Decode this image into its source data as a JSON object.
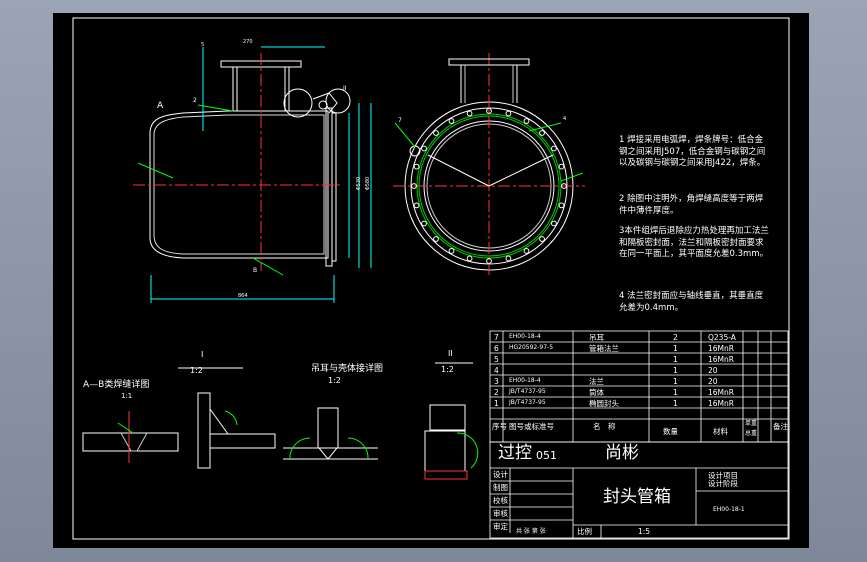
{
  "drawing": {
    "title": "封头管箱",
    "code": "EH00-18-1",
    "scale": "1:5",
    "watermark_part1": "过控",
    "watermark_part2": "051",
    "watermark_part3": "尚彬"
  },
  "notes": [
    "1 焊接采用电弧焊，焊条牌号：低合金钢之间采用J507，低合金钢与碳钢之间以及碳钢与碳钢之间采用J422，焊条。",
    "2 除图中注明外，角焊缝高度等于两焊件中薄件厚度。",
    "3本件组焊后退除应力热处理再加工法兰和隔板密封面，法兰和隔板密封面要求在同一平面上，其平面度允差0.3mm。",
    "4 法兰密封面应与轴线垂直，其垂直度允差为0.4mm。"
  ],
  "detail_labels": {
    "section_ab": "A—B类焊缝详图",
    "section_ab_scale": "1:1",
    "detail_i_num": "I",
    "detail_i_scale": "1:2",
    "lug_title": "吊耳与壳体接详图",
    "lug_scale": "1:2",
    "detail_ii_num": "II",
    "detail_ii_scale": "1:2"
  },
  "bom": {
    "headers": [
      "序号",
      "图号或标准号",
      "名　称",
      "数量",
      "材料",
      "单重",
      "总重",
      "备注"
    ],
    "rows": [
      {
        "no": "7",
        "std": "EH00-18-4",
        "name": "吊耳",
        "qty": "2",
        "mat": "Q235-A"
      },
      {
        "no": "6",
        "std": "HG20592-97-5",
        "name": "管箱法兰",
        "qty": "1",
        "mat": "16MnR"
      },
      {
        "no": "5",
        "std": "",
        "name": "",
        "qty": "1",
        "mat": "16MnR"
      },
      {
        "no": "4",
        "std": "",
        "name": "",
        "qty": "1",
        "mat": "20"
      },
      {
        "no": "3",
        "std": "EH00-18-4",
        "name": "法兰",
        "qty": "1",
        "mat": "20"
      },
      {
        "no": "2",
        "std": "JB/T4737-95",
        "name": "筒体",
        "qty": "1",
        "mat": "16MnR"
      },
      {
        "no": "1",
        "std": "JB/T4737-95",
        "name": "椭圆封头",
        "qty": "1",
        "mat": "16MnR"
      }
    ]
  },
  "title_block": {
    "roles": [
      "设计",
      "制图",
      "校核",
      "审核",
      "审定"
    ],
    "design_project": "设计项目",
    "design_stage": "设计阶段",
    "scale_label": "比例",
    "sheet_label": "共 张 第 张"
  },
  "dims": {
    "vessel_top": "270",
    "vessel_total": "864",
    "right_a": "Φ530",
    "right_b": "Φ580",
    "marker_2": "2",
    "marker_5": "5",
    "marker_i": "I",
    "marker_ii": "II",
    "marker_4": "4",
    "marker_7": "7",
    "label_a": "A",
    "label_b": "B"
  }
}
